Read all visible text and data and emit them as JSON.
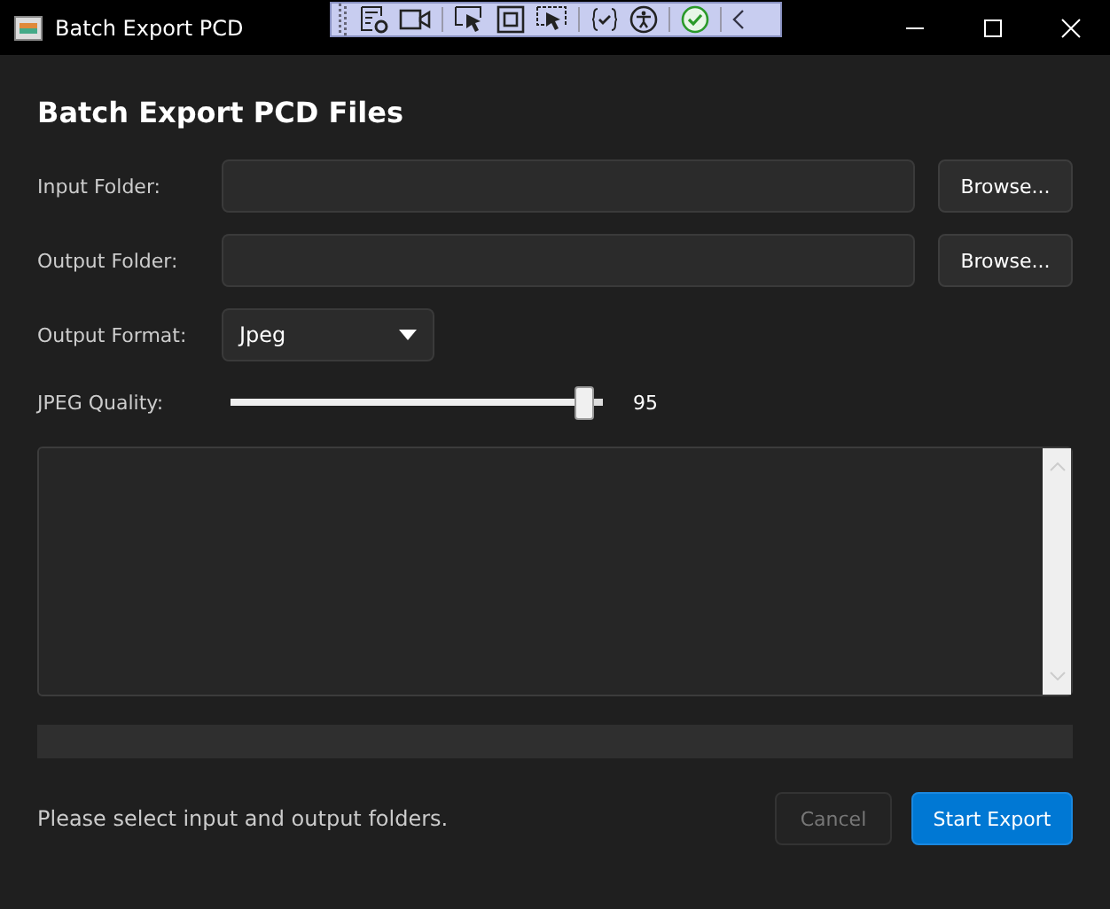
{
  "window": {
    "title": "Batch Export PCD"
  },
  "heading": "Batch Export PCD Files",
  "folders": [
    {
      "label": "Input Folder:",
      "button": "Browse..."
    },
    {
      "label": "Output Folder:",
      "button": "Browse..."
    }
  ],
  "format": {
    "label": "Output Format:",
    "value": "Jpeg"
  },
  "quality": {
    "label": "JPEG Quality:",
    "level": 0.95,
    "reading": "95"
  },
  "status": "Please select input and output folders.",
  "buttons": [
    {
      "label": "Cancel",
      "kind": "secondary",
      "disabled": true
    },
    {
      "label": "Start Export",
      "kind": "primary",
      "disabled": false
    }
  ]
}
